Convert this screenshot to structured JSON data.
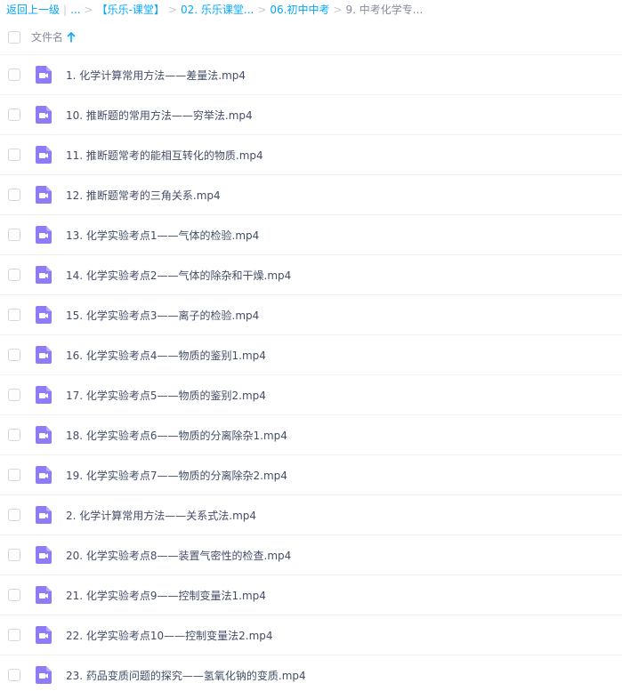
{
  "breadcrumb": {
    "back": "返回上一级",
    "ellipsis": "...",
    "crumbs": [
      "【乐乐-课堂】",
      "02. 乐乐课堂...",
      "06.初中中考"
    ],
    "current": "9. 中考化学专..."
  },
  "header": {
    "column_name": "文件名",
    "sort_icon": "arrow-up-icon"
  },
  "colors": {
    "accent": "#06a7ff",
    "video_icon": "#8d7cf6"
  },
  "files": [
    {
      "name": "1. 化学计算常用方法——差量法.mp4",
      "icon": "video-file-icon"
    },
    {
      "name": "10. 推断题的常用方法——穷举法.mp4",
      "icon": "video-file-icon"
    },
    {
      "name": "11. 推断题常考的能相互转化的物质.mp4",
      "icon": "video-file-icon"
    },
    {
      "name": "12. 推断题常考的三角关系.mp4",
      "icon": "video-file-icon"
    },
    {
      "name": "13. 化学实验考点1——气体的检验.mp4",
      "icon": "video-file-icon"
    },
    {
      "name": "14. 化学实验考点2——气体的除杂和干燥.mp4",
      "icon": "video-file-icon"
    },
    {
      "name": "15. 化学实验考点3——离子的检验.mp4",
      "icon": "video-file-icon"
    },
    {
      "name": "16. 化学实验考点4——物质的鉴别1.mp4",
      "icon": "video-file-icon"
    },
    {
      "name": "17. 化学实验考点5——物质的鉴别2.mp4",
      "icon": "video-file-icon"
    },
    {
      "name": "18. 化学实验考点6——物质的分离除杂1.mp4",
      "icon": "video-file-icon"
    },
    {
      "name": "19. 化学实验考点7——物质的分离除杂2.mp4",
      "icon": "video-file-icon"
    },
    {
      "name": "2. 化学计算常用方法——关系式法.mp4",
      "icon": "video-file-icon"
    },
    {
      "name": "20. 化学实验考点8——装置气密性的检查.mp4",
      "icon": "video-file-icon"
    },
    {
      "name": "21. 化学实验考点9——控制变量法1.mp4",
      "icon": "video-file-icon"
    },
    {
      "name": "22. 化学实验考点10——控制变量法2.mp4",
      "icon": "video-file-icon"
    },
    {
      "name": "23. 药品变质问题的探究——氢氧化钠的变质.mp4",
      "icon": "video-file-icon"
    }
  ]
}
